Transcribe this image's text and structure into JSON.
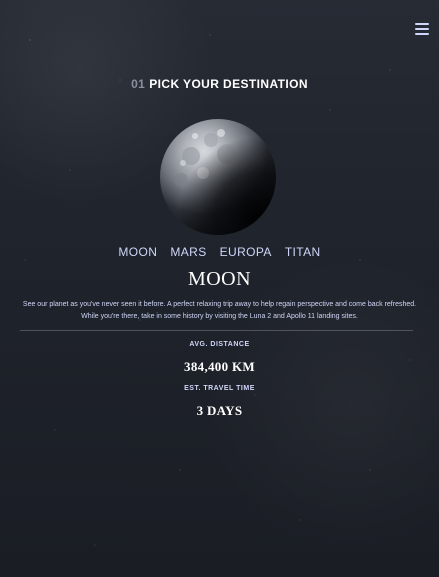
{
  "menu": {
    "icon": "hamburger-menu-icon"
  },
  "page": {
    "number": "01",
    "title": "PICK YOUR DESTINATION"
  },
  "planet": {
    "image": "moon-image"
  },
  "tabs": [
    {
      "label": "MOON",
      "active": true
    },
    {
      "label": "MARS",
      "active": false
    },
    {
      "label": "EUROPA",
      "active": false
    },
    {
      "label": "TITAN",
      "active": false
    }
  ],
  "destination": {
    "name": "MOON",
    "description": "See our planet as you've never seen it before. A perfect relaxing trip away to help regain perspective and come back refreshed. While you're there, take in some history by visiting the Luna 2 and Apollo 11 landing sites."
  },
  "stats": {
    "distance_label": "AVG. DISTANCE",
    "distance_value": "384,400 KM",
    "travel_label": "EST. TRAVEL TIME",
    "travel_value": "3 DAYS"
  },
  "colors": {
    "background": "#20242c",
    "accent": "#d0d6f9",
    "heading_number": "#8a8f9f",
    "text": "#ffffff"
  }
}
